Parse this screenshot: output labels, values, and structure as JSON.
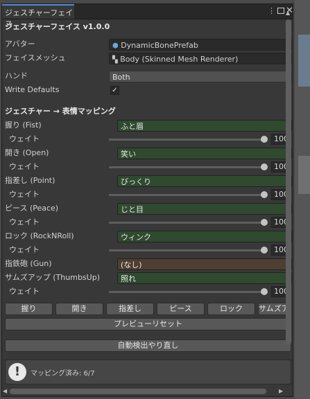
{
  "window": {
    "tab_title": "ジェスチャーフェイス"
  },
  "header": {
    "title": "ジェスチャーフェイス v1.0.0"
  },
  "settings": {
    "avatar_label": "アバター",
    "avatar_value": "DynamicBonePrefab",
    "face_mesh_label": "フェイスメッシュ",
    "face_mesh_value": "Body (Skinned Mesh Renderer)",
    "hand_label": "ハンド",
    "hand_value": "Both",
    "write_defaults_label": "Write Defaults",
    "write_defaults_checked": true,
    "write_defaults_mark": "✓"
  },
  "mapping": {
    "section_title": "ジェスチャー → 表情マッピング",
    "weight_label": "ウェイト",
    "gestures": [
      {
        "label": "握り (Fist)",
        "value": "ふと眉",
        "weight": "100",
        "color": "#2f4a2f"
      },
      {
        "label": "開き (Open)",
        "value": "笑い",
        "weight": "100",
        "color": "#2f4a2f"
      },
      {
        "label": "指差し (Point)",
        "value": "びっくり",
        "weight": "100",
        "color": "#2f4a2f"
      },
      {
        "label": "ピース (Peace)",
        "value": "じと目",
        "weight": "100",
        "color": "#2f4a2f"
      },
      {
        "label": "ロック (RockNRoll)",
        "value": "ウィンク",
        "weight": "100",
        "color": "#2f4a2f"
      },
      {
        "label": "指鉄砲 (Gun)",
        "value": "(なし)",
        "color": "#4f3f30"
      },
      {
        "label": "サムズアップ (ThumbsUp)",
        "value": "照れ",
        "weight": "100",
        "color": "#2f4a2f"
      }
    ]
  },
  "preview_buttons": [
    "握り",
    "開き",
    "指差し",
    "ピース",
    "ロック",
    "サムズアップ"
  ],
  "actions": {
    "preview_reset": "プレビューリセット",
    "auto_detect_redo": "自動検出やり直し"
  },
  "status": {
    "mapped_text": "マッピング済み: 6/7"
  },
  "icons": {
    "menu": "kebab-menu-icon",
    "maximize": "maximize-icon",
    "close": "close-icon",
    "prefab": "prefab-icon",
    "mesh": "mesh-renderer-icon",
    "info": "exclamation-icon"
  },
  "colors": {
    "accent_tab": "#4d8ee0",
    "mapped": "#2f4a2f",
    "unmapped": "#4f3f30"
  }
}
